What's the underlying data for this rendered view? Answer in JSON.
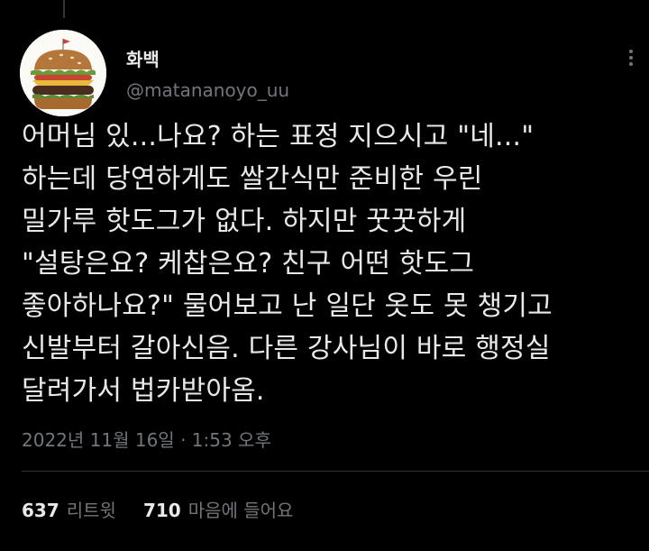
{
  "author": {
    "display_name": "화백",
    "handle": "@matananoyo_uu"
  },
  "tweet": {
    "text": "어머님 있...나요? 하는 표정 지으시고 \"네...\"\n하는데 당연하게도 쌀간식만 준비한 우린\n밀가루 핫도그가 없다. 하지만 꿋꿋하게\n\"설탕은요? 케찹은요? 친구 어떤 핫도그\n좋아하나요?\" 물어보고 난 일단 옷도 못 챙기고\n신발부터 갈아신음. 다른 강사님이 바로 행정실\n달려가서 법카받아옴.",
    "timestamp": "2022년 11월 16일 · 1:53 오후"
  },
  "stats": {
    "retweets_count": "637",
    "retweets_label": "리트윗",
    "likes_count": "710",
    "likes_label": "마음에 들어요"
  },
  "icons": {
    "avatar": "burger-avatar-icon",
    "more": "more-options-icon"
  },
  "colors": {
    "background": "#000000",
    "text_primary": "#e7e9ea",
    "text_secondary": "#71767b",
    "divider": "#2f3336"
  }
}
